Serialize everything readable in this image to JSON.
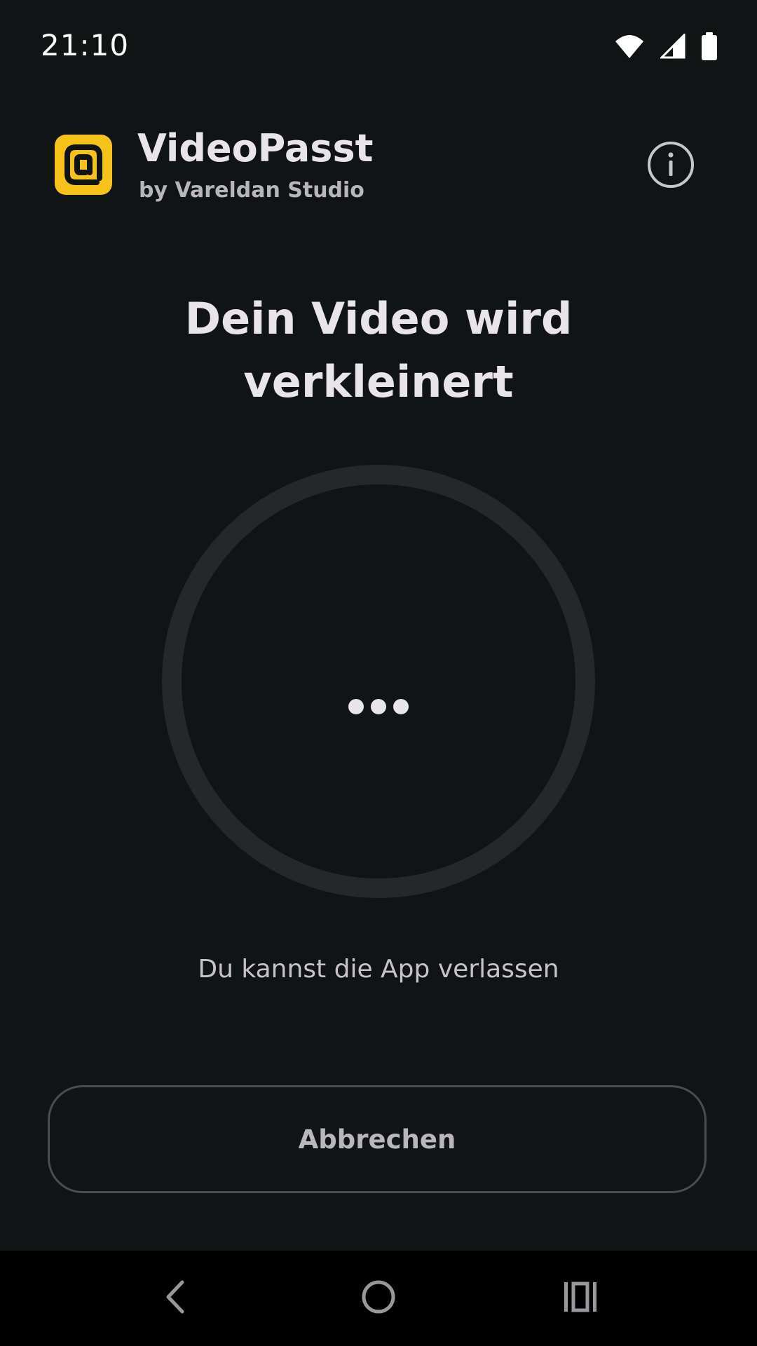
{
  "status_bar": {
    "time": "21:10",
    "icons": [
      "wifi-icon",
      "signal-icon",
      "battery-icon"
    ]
  },
  "header": {
    "title": "VideoPasst",
    "subtitle": "by Vareldan Studio",
    "logo_icon": "app-logo-icon",
    "info_icon": "info-icon"
  },
  "main": {
    "heading_line1": "Dein Video wird",
    "heading_line2": "verkleinert",
    "hint": "Du kannst die App verlassen",
    "cancel_label": "Abbrechen"
  },
  "nav_bar": {
    "icons": [
      "back-icon",
      "home-icon",
      "recents-icon"
    ]
  },
  "colors": {
    "background": "#111415",
    "accent": "#f7c21a",
    "text": "#e9e3ea",
    "ring": "#25282b"
  }
}
